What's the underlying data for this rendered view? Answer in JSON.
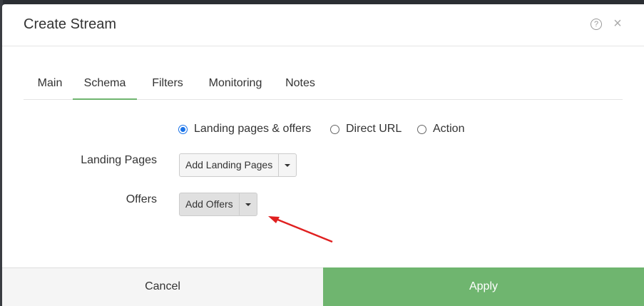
{
  "modal": {
    "title": "Create Stream",
    "help_icon": "question-circle-icon",
    "help_glyph": "?",
    "close_icon": "close-icon",
    "close_glyph": "×"
  },
  "tabs": [
    {
      "label": "Main",
      "active": false
    },
    {
      "label": "Schema",
      "active": true
    },
    {
      "label": "Filters",
      "active": false
    },
    {
      "label": "Monitoring",
      "active": false
    },
    {
      "label": "Notes",
      "active": false
    }
  ],
  "schema": {
    "options": [
      {
        "label": "Landing pages & offers",
        "selected": true
      },
      {
        "label": "Direct URL",
        "selected": false
      },
      {
        "label": "Action",
        "selected": false
      }
    ],
    "landing_pages": {
      "label": "Landing Pages",
      "button": "Add Landing Pages"
    },
    "offers": {
      "label": "Offers",
      "button": "Add Offers"
    }
  },
  "footer": {
    "cancel": "Cancel",
    "apply": "Apply"
  },
  "colors": {
    "accent": "#6fb56f",
    "radio_selected": "#1a73e8",
    "annotation_arrow": "#e02020"
  }
}
